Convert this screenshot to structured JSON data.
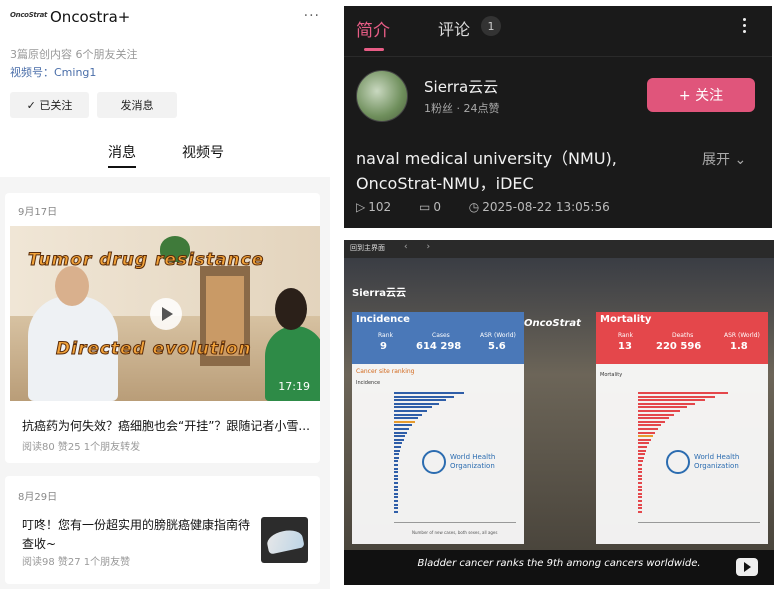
{
  "left_panel": {
    "logo_text": "OncoStrat",
    "app_name": "Oncostra+",
    "more_icon": "more-dots-icon",
    "meta_line": "3篇原创内容  6个朋友关注",
    "channel_id": "视频号：Cming1",
    "follow_button": "✓ 已关注",
    "message_button": "发消息",
    "tabs": [
      "消息",
      "视频号"
    ],
    "posts": [
      {
        "date": "9月17日",
        "overlay_top": "Tumor drug resistance",
        "overlay_bottom": "Directed evolution",
        "duration": "17:19",
        "title": "抗癌药为何失效？癌细胞也会“开挂”？跟随记者小雪...",
        "meta": "阅读80  赞25  1个朋友转发"
      },
      {
        "date": "8月29日",
        "title": "叮咚！您有一份超实用的膀胱癌健康指南待查收~",
        "meta": "阅读98  赞27  1个朋友赞"
      }
    ]
  },
  "right_top": {
    "tab_intro": "简介",
    "tab_comments": "评论",
    "comment_count": "1",
    "user_name": "Sierra云云",
    "user_stats": "1粉丝 · 24点赞",
    "follow_button": "+ 关注",
    "description": "naval medical university（NMU), OncoStrat-NMU，iDEC",
    "expand": "展开 ⌄",
    "views": "102",
    "comments": "0",
    "timestamp": "2025-08-22 13:05:56"
  },
  "right_bottom": {
    "back_home": "回到主界面",
    "watermark": "Sierra云云",
    "brand": "OncoStrat",
    "subtitle": "Bladder cancer ranks the 9th among cancers worldwide.",
    "incidence": {
      "title": "Incidence",
      "rank_label": "Rank",
      "rank": "9",
      "cases_label": "Cases",
      "cases": "614 298",
      "asr_label": "ASR (World)",
      "asr": "5.6",
      "section": "Cancer site ranking",
      "chart_label": "Incidence"
    },
    "mortality": {
      "title": "Mortality",
      "rank_label": "Rank",
      "rank": "13",
      "deaths_label": "Deaths",
      "deaths": "220 596",
      "asr_label": "ASR (World)",
      "asr": "1.8",
      "chart_label": "Mortality"
    },
    "who_name": "World Health Organization",
    "x_axis_label": "Number of new cases, both sexes, all ages"
  }
}
